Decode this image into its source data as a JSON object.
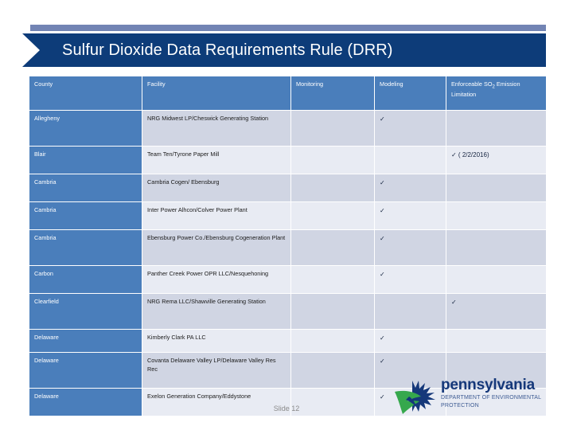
{
  "slide": {
    "title": "Sulfur Dioxide Data Requirements Rule (DRR)",
    "number_label": "Slide 12"
  },
  "colors": {
    "banner_blue": "#0d3c79",
    "accent_bar": "#7284b4",
    "table_header_blue": "#4a7ebb",
    "row_band_a": "#d0d5e3",
    "row_band_b": "#e8ebf3",
    "logo_blue": "#15387a",
    "logo_green": "#36a84d"
  },
  "table": {
    "columns": [
      {
        "key": "county",
        "label": "County"
      },
      {
        "key": "facility",
        "label": "Facility"
      },
      {
        "key": "monitoring",
        "label": "Monitoring"
      },
      {
        "key": "modeling",
        "label": "Modeling"
      },
      {
        "key": "limitation_line1",
        "label": "Enforceable SO"
      },
      {
        "key": "limitation_sub",
        "label": "2"
      },
      {
        "key": "limitation_line1b",
        "label": " Emission"
      },
      {
        "key": "limitation_line2",
        "label": "Limitation"
      }
    ],
    "header": {
      "county": "County",
      "facility": "Facility",
      "monitoring": "Monitoring",
      "modeling": "Modeling",
      "limitation_pre": "Enforceable SO",
      "limitation_sub": "2",
      "limitation_post": " Emission",
      "limitation_line2": "Limitation"
    },
    "check_glyph": "✓",
    "rows": [
      {
        "county": "Allegheny",
        "facility": "NRG Midwest LP/Cheswick Generating Station",
        "monitoring": "",
        "modeling": "✓",
        "limitation": ""
      },
      {
        "county": "Blair",
        "facility": "Team Ten/Tyrone Paper Mill",
        "monitoring": "",
        "modeling": "",
        "limitation": "✓  ( 2/2/2016)"
      },
      {
        "county": "Cambria",
        "facility": "Cambria Cogen/ Ebensburg",
        "monitoring": "",
        "modeling": "✓",
        "limitation": ""
      },
      {
        "county": "Cambria",
        "facility": "Inter Power Alhcon/Colver Power Plant",
        "monitoring": "",
        "modeling": "✓",
        "limitation": ""
      },
      {
        "county": "Cambria",
        "facility": "Ebensburg Power Co./Ebensburg Cogeneration Plant",
        "monitoring": "",
        "modeling": "✓",
        "limitation": ""
      },
      {
        "county": "Carbon",
        "facility": "Panther Creek Power OPR LLC/Nesquehoning",
        "monitoring": "",
        "modeling": "✓",
        "limitation": ""
      },
      {
        "county": "Clearfield",
        "facility": "NRG Rema LLC/Shawville Generating Station",
        "monitoring": "",
        "modeling": "",
        "limitation": "✓"
      },
      {
        "county": "Delaware",
        "facility": "Kimberly Clark PA LLC",
        "monitoring": "",
        "modeling": "✓",
        "limitation": ""
      },
      {
        "county": "Delaware",
        "facility": "Covanta Delaware Valley LP/Delaware Valley Res Rec",
        "monitoring": "",
        "modeling": "✓",
        "limitation": ""
      },
      {
        "county": "Delaware",
        "facility": "Exelon Generation Company/Eddystone",
        "monitoring": "",
        "modeling": "✓",
        "limitation": ""
      }
    ]
  },
  "logo": {
    "wordmark": "pennsylvania",
    "subtitle_line1": "DEPARTMENT OF ENVIRONMENTAL",
    "subtitle_line2": "PROTECTION"
  }
}
